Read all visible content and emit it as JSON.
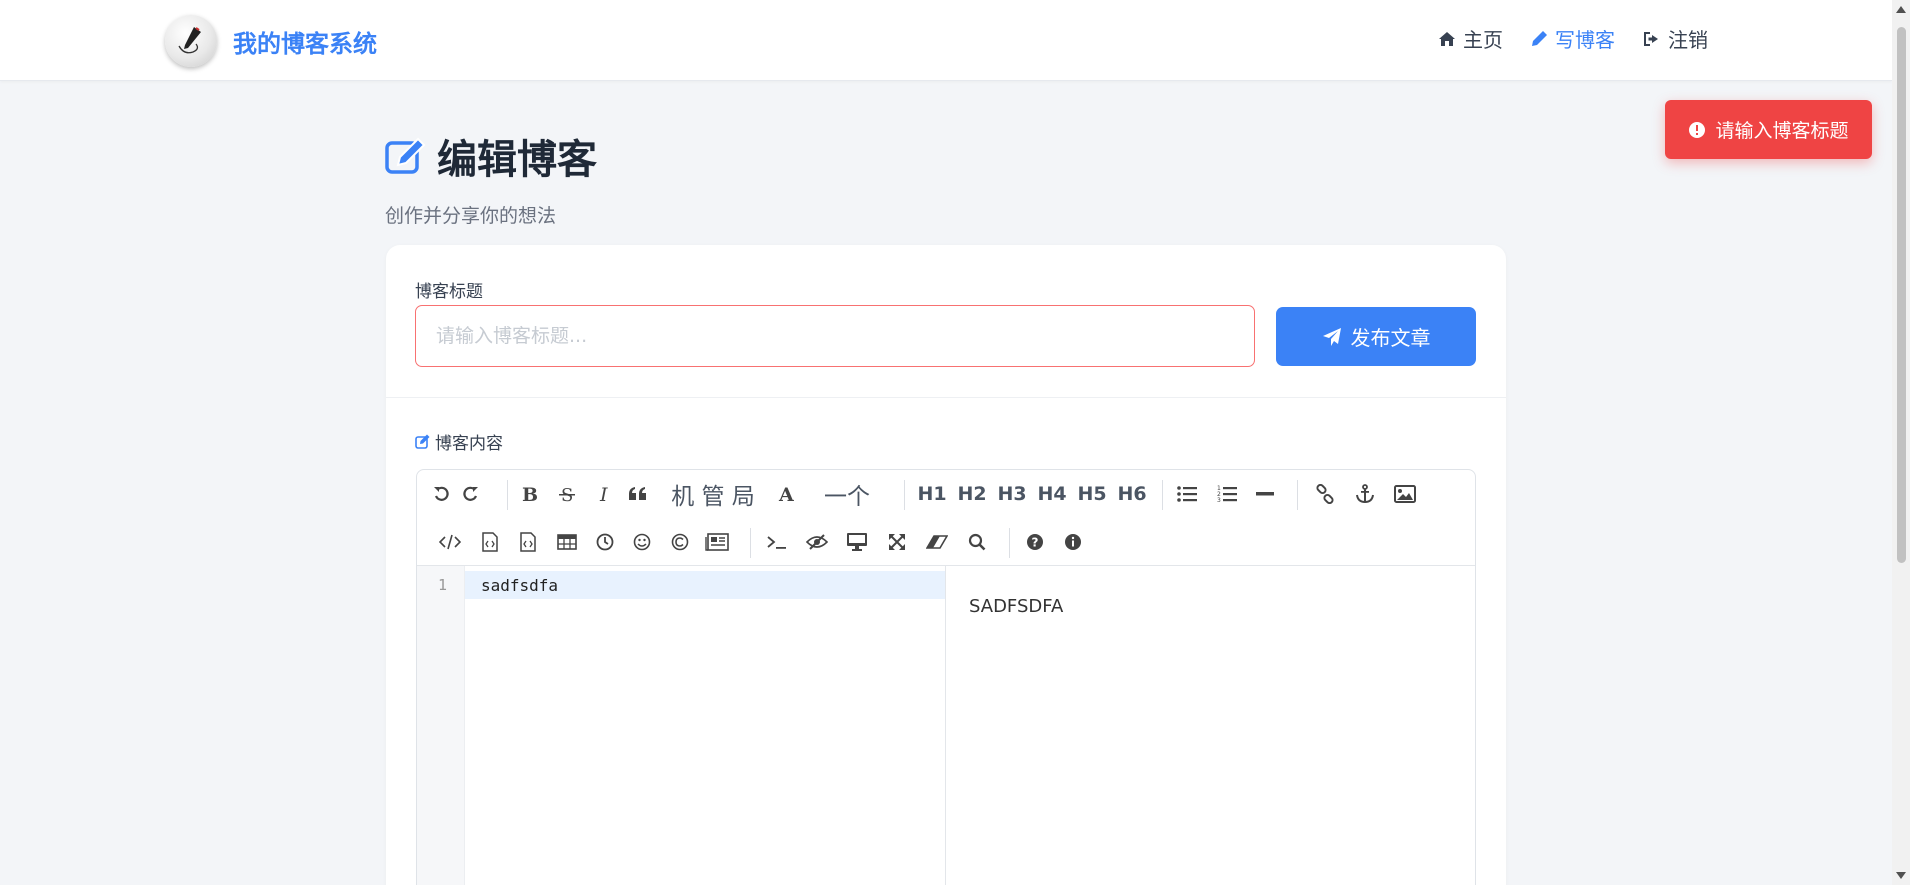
{
  "header": {
    "brand_title": "我的博客系统",
    "nav": [
      {
        "label": "主页",
        "icon": "home-icon",
        "active": false
      },
      {
        "label": "写博客",
        "icon": "pencil-icon",
        "active": true
      },
      {
        "label": "注销",
        "icon": "sign-out-icon",
        "active": false
      }
    ]
  },
  "toast": {
    "message": "请输入博客标题",
    "icon": "exclamation-circle-icon",
    "color": "#ef4444"
  },
  "page": {
    "title": "编辑博客",
    "subtitle": "创作并分享你的想法"
  },
  "form": {
    "title_label": "博客标题",
    "title_value": "",
    "title_placeholder": "请输入博客标题...",
    "publish_label": "发布文章",
    "content_label": "博客内容"
  },
  "editor": {
    "toolbar_text": {
      "cjk_group": "机 管 局",
      "font_a": "A",
      "one_ge": "一个",
      "h1": "H1",
      "h2": "H2",
      "h3": "H3",
      "h4": "H4",
      "h5": "H5",
      "h6": "H6"
    },
    "line_number": "1",
    "code_line": "sadfsdfa",
    "preview_text": "SADFSDFA"
  },
  "colors": {
    "accent": "#3b82f6",
    "error": "#ef4444",
    "background": "#f3f5f8"
  }
}
